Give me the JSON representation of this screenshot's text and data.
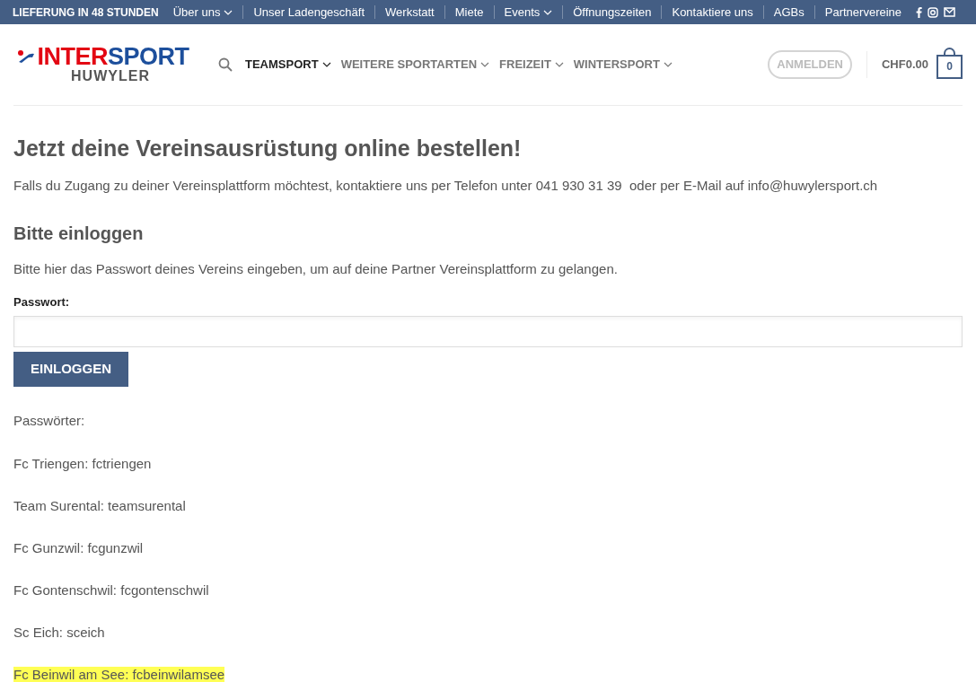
{
  "top_bar": {
    "tagline": "LIEFERUNG IN 48 STUNDEN",
    "links": [
      {
        "label": "Über uns",
        "dropdown": true
      },
      {
        "label": "Unser Ladengeschäft",
        "dropdown": false
      },
      {
        "label": "Werkstatt",
        "dropdown": false
      },
      {
        "label": "Miete",
        "dropdown": false
      },
      {
        "label": "Events",
        "dropdown": true
      },
      {
        "label": "Öffnungszeiten",
        "dropdown": false
      },
      {
        "label": "Kontaktiere uns",
        "dropdown": false
      },
      {
        "label": "AGBs",
        "dropdown": false
      },
      {
        "label": "Partnervereine",
        "dropdown": false
      }
    ]
  },
  "header": {
    "logo": {
      "part_1": "INTER",
      "part_2": "SPORT",
      "sub": "HUWYLER"
    },
    "nav": [
      {
        "label": "TEAMSPORT",
        "selected": true
      },
      {
        "label": "WEITERE SPORTARTEN",
        "selected": false
      },
      {
        "label": "FREIZEIT",
        "selected": false
      },
      {
        "label": "WINTERSPORT",
        "selected": false
      }
    ],
    "login_button": "ANMELDEN",
    "cart_total": "CHF0.00",
    "cart_count": "0"
  },
  "content": {
    "title": "Jetzt deine Vereinsausrüstung online bestellen!",
    "intro": "Falls du Zugang zu deiner Vereinsplattform möchtest, kontaktiere uns per Telefon unter 041 930 31 39  oder per E-Mail auf info@huwylersport.ch",
    "login_heading": "Bitte einloggen",
    "login_text": "Bitte hier das Passwort deines Vereins eingeben, um auf deine Partner Vereinsplattform zu gelangen.",
    "password_label": "Passwort:",
    "submit": "EINLOGGEN",
    "list_heading": "Passwörter:",
    "entries": [
      {
        "text": "Fc Triengen: fctriengen",
        "highlighted": false
      },
      {
        "text": "Team Surental: teamsurental",
        "highlighted": false
      },
      {
        "text": "Fc Gunzwil: fcgunzwil",
        "highlighted": false
      },
      {
        "text": "Fc Gontenschwil: fcgontenschwil",
        "highlighted": false
      },
      {
        "text": "Sc Eich: sceich",
        "highlighted": false
      },
      {
        "text": "Fc Beinwil am See: fcbeinwilamsee",
        "highlighted": true
      }
    ]
  }
}
